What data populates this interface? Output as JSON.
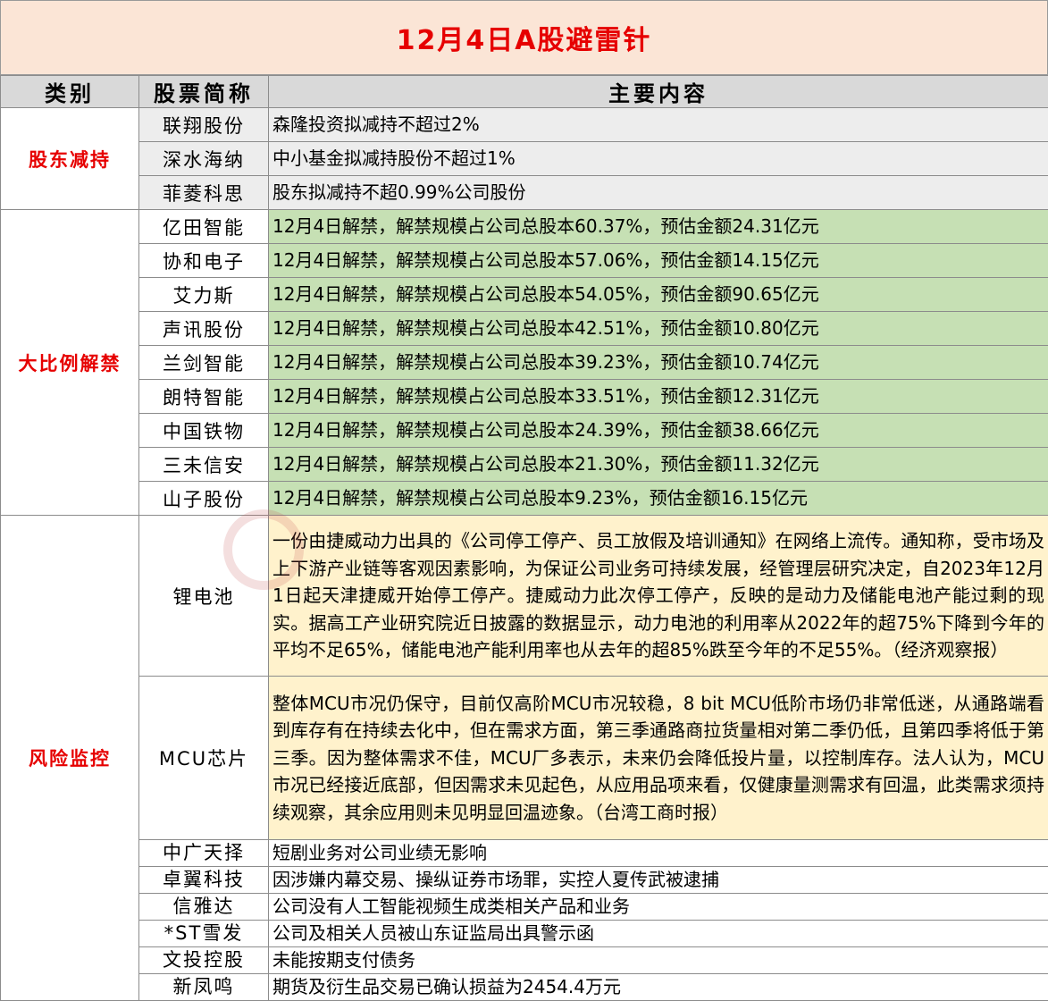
{
  "title": "12月4日A股避雷针",
  "headers": {
    "category": "类别",
    "stock": "股票简称",
    "content": "主要内容"
  },
  "categories": {
    "reduce": "股东减持",
    "unlock": "大比例解禁",
    "risk": "风险监控"
  },
  "rows": [
    {
      "name": "联翔股份",
      "content": "森隆投资拟减持不超过2%"
    },
    {
      "name": "深水海纳",
      "content": "中小基金拟减持股份不超过1%"
    },
    {
      "name": "菲菱科思",
      "content": "股东拟减持不超0.99%公司股份"
    },
    {
      "name": "亿田智能",
      "content": "12月4日解禁，解禁规模占公司总股本60.37%，预估金额24.31亿元"
    },
    {
      "name": "协和电子",
      "content": "12月4日解禁，解禁规模占公司总股本57.06%，预估金额14.15亿元"
    },
    {
      "name": "艾力斯",
      "content": "12月4日解禁，解禁规模占公司总股本54.05%，预估金额90.65亿元"
    },
    {
      "name": "声讯股份",
      "content": "12月4日解禁，解禁规模占公司总股本42.51%，预估金额10.80亿元"
    },
    {
      "name": "兰剑智能",
      "content": "12月4日解禁，解禁规模占公司总股本39.23%，预估金额10.74亿元"
    },
    {
      "name": "朗特智能",
      "content": "12月4日解禁，解禁规模占公司总股本33.51%，预估金额12.31亿元"
    },
    {
      "name": "中国铁物",
      "content": "12月4日解禁，解禁规模占公司总股本24.39%，预估金额38.66亿元"
    },
    {
      "name": "三未信安",
      "content": "12月4日解禁，解禁规模占公司总股本21.30%，预估金额11.32亿元"
    },
    {
      "name": "山子股份",
      "content": "12月4日解禁，解禁规模占公司总股本9.23%，预估金额16.15亿元"
    },
    {
      "name": "锂电池",
      "content": "一份由捷威动力出具的《公司停工停产、员工放假及培训通知》在网络上流传。通知称，受市场及上下游产业链等客观因素影响，为保证公司业务可持续发展，经管理层研究决定，自2023年12月1日起天津捷威开始停工停产。捷威动力此次停工停产，反映的是动力及储能电池产能过剩的现实。据高工产业研究院近日披露的数据显示，动力电池的利用率从2022年的超75%下降到今年的平均不足65%，储能电池产能利用率也从去年的超85%跌至今年的不足55%。（经济观察报）"
    },
    {
      "name": "MCU芯片",
      "content": "整体MCU市况仍保守，目前仅高阶MCU市况较稳，8 bit MCU低阶市场仍非常低迷，从通路端看到库存有在持续去化中，但在需求方面，第三季通路商拉货量相对第二季仍低，且第四季将低于第三季。因为整体需求不佳，MCU厂多表示，未来仍会降低投片量，以控制库存。法人认为，MCU市况已经接近底部，但因需求未见起色，从应用品项来看，仅健康量测需求有回温，此类需求须持续观察，其余应用则未见明显回温迹象。（台湾工商时报）"
    },
    {
      "name": "中广天择",
      "content": "短剧业务对公司业绩无影响"
    },
    {
      "name": "卓翼科技",
      "content": "因涉嫌内幕交易、操纵证券市场罪，实控人夏传武被逮捕"
    },
    {
      "name": "信雅达",
      "content": "公司没有人工智能视频生成类相关产品和业务"
    },
    {
      "name": "*ST雪发",
      "content": "公司及相关人员被山东证监局出具警示函"
    },
    {
      "name": "文投控股",
      "content": "未能按期支付债务"
    },
    {
      "name": "新凤鸣",
      "content": "期货及衍生品交易已确认损益为2454.4万元"
    }
  ],
  "colors": {
    "title_bg": "#fbe5d6",
    "title_text": "#e60000",
    "header_bg": "#d9d9d9",
    "reduce_bg": "#ededed",
    "unlock_bg": "#c6e0b4",
    "risk_bg": "#fff2cc"
  }
}
